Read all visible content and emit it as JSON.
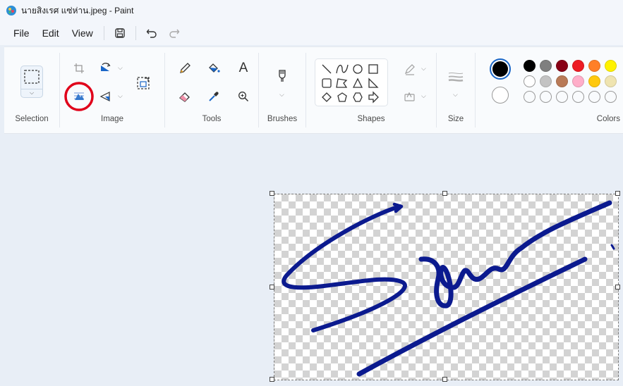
{
  "window": {
    "title": "นายสิงเรศ แซ่ห่าน.jpeg - Paint"
  },
  "menu": {
    "file": "File",
    "edit": "Edit",
    "view": "View"
  },
  "groups": {
    "selection": "Selection",
    "image": "Image",
    "tools": "Tools",
    "brushes": "Brushes",
    "shapes": "Shapes",
    "size": "Size",
    "colors": "Colors"
  },
  "tools": {
    "text_tool_glyph": "A"
  },
  "colors": {
    "primary": "#000000",
    "secondary": "#ffffff",
    "accent_stroke": "#0b1a8f",
    "highlight_ring": "#e0001a",
    "palette_row1": [
      "#000000",
      "#7f7f7f",
      "#880015",
      "#ed1c24",
      "#ff7f27",
      "#fff200"
    ],
    "palette_row2": [
      "#ffffff",
      "#c3c3c3",
      "#b97a57",
      "#ffaec9",
      "#ffc90e",
      "#efe4b0"
    ],
    "palette_row3": [
      "",
      "",
      "",
      "",
      "",
      ""
    ]
  }
}
